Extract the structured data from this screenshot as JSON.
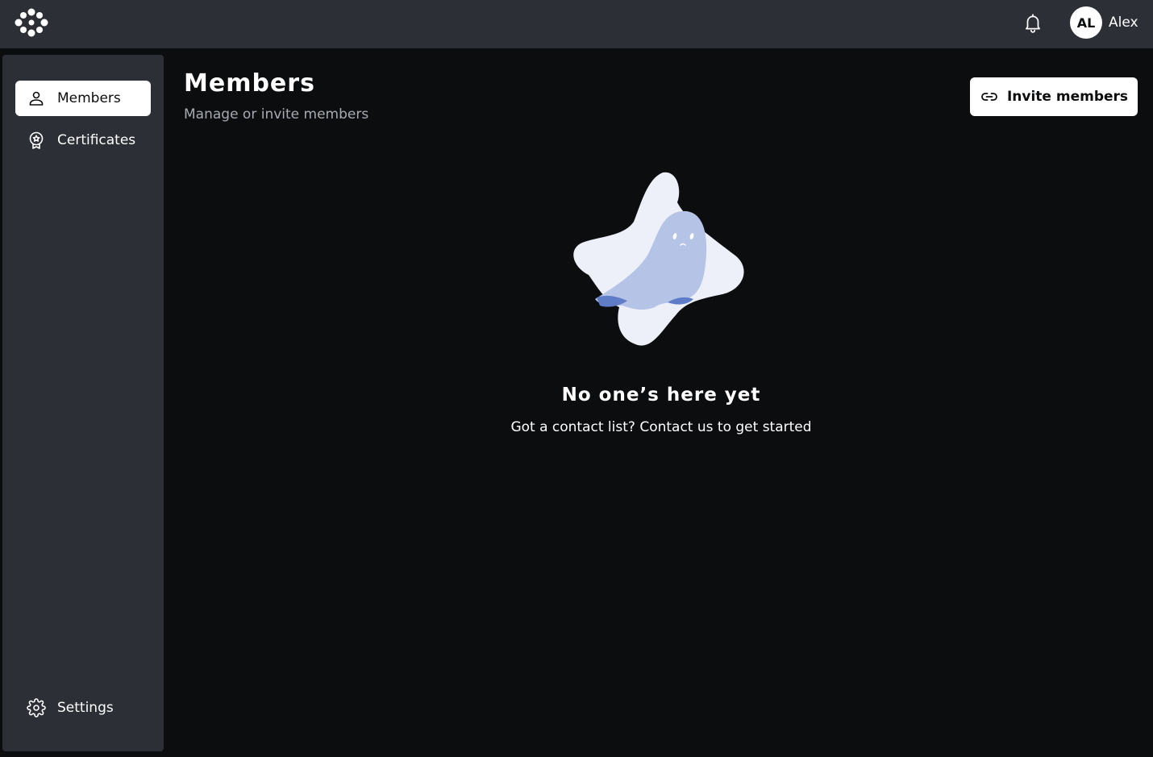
{
  "topbar": {
    "logo_icon": "app-logo-icon",
    "notifications_icon": "bell-icon",
    "user": {
      "initials": "AL",
      "name": "Alex"
    }
  },
  "sidebar": {
    "items": [
      {
        "label": "Members",
        "icon": "person-icon",
        "active": true
      },
      {
        "label": "Certificates",
        "icon": "certificate-badge-icon",
        "active": false
      }
    ],
    "footer_item": {
      "label": "Settings",
      "icon": "gear-icon"
    }
  },
  "main": {
    "title": "Members",
    "subtitle": "Manage or invite members",
    "invite_button": {
      "label": "Invite members",
      "icon": "link-icon"
    },
    "empty_state": {
      "illustration": "ghost-illustration",
      "title": "No one’s here yet",
      "message": "Got a contact list? Contact us to get started"
    }
  },
  "colors": {
    "topbar_bg": "#2c2f35",
    "page_bg": "#0c0d0f",
    "sidebar_bg": "#2c2f35",
    "accent_light": "#ffffff",
    "ghost_body": "#b4c3e6",
    "ghost_shadow": "#5f7cc7",
    "blob": "#edf0f8"
  }
}
